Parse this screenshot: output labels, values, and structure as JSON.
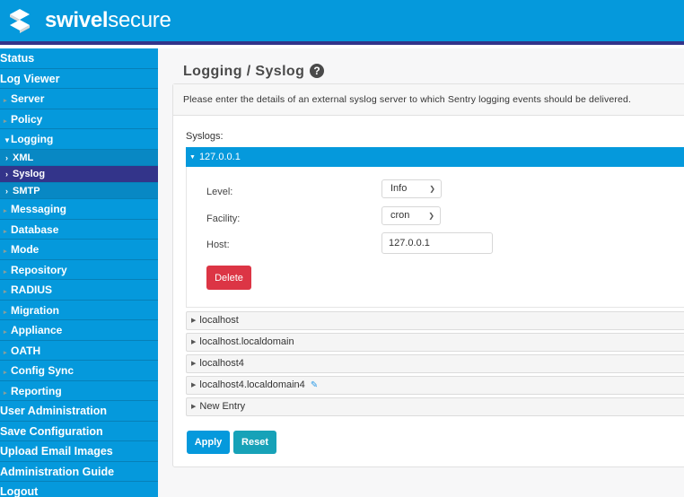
{
  "header": {
    "brand_bold": "swivel",
    "brand_light": "secure"
  },
  "sidebar": {
    "items": [
      {
        "label": "Status",
        "level": "top"
      },
      {
        "label": "Log Viewer",
        "level": "top"
      },
      {
        "label": "Server",
        "level": "sub"
      },
      {
        "label": "Policy",
        "level": "sub"
      },
      {
        "label": "Logging",
        "level": "sub",
        "open": true
      },
      {
        "label": "XML",
        "level": "subsub"
      },
      {
        "label": "Syslog",
        "level": "subsub",
        "active": true
      },
      {
        "label": "SMTP",
        "level": "subsub"
      },
      {
        "label": "Messaging",
        "level": "sub"
      },
      {
        "label": "Database",
        "level": "sub"
      },
      {
        "label": "Mode",
        "level": "sub"
      },
      {
        "label": "Repository",
        "level": "sub"
      },
      {
        "label": "RADIUS",
        "level": "sub"
      },
      {
        "label": "Migration",
        "level": "sub"
      },
      {
        "label": "Appliance",
        "level": "sub"
      },
      {
        "label": "OATH",
        "level": "sub"
      },
      {
        "label": "Config Sync",
        "level": "sub"
      },
      {
        "label": "Reporting",
        "level": "sub"
      },
      {
        "label": "User Administration",
        "level": "top"
      },
      {
        "label": "Save Configuration",
        "level": "top"
      },
      {
        "label": "Upload Email Images",
        "level": "top"
      },
      {
        "label": "Administration Guide",
        "level": "top"
      },
      {
        "label": "Logout",
        "level": "top"
      }
    ]
  },
  "main": {
    "title": "Logging / Syslog",
    "help_glyph": "?",
    "description": "Please enter the details of an external syslog server to which Sentry logging events should be delivered.",
    "syslogs_label": "Syslogs:",
    "open_entry": {
      "name": "127.0.0.1",
      "level_label": "Level:",
      "level_value": "Info",
      "facility_label": "Facility:",
      "facility_value": "cron",
      "host_label": "Host:",
      "host_value": "127.0.0.1",
      "delete_label": "Delete"
    },
    "collapsed_entries": [
      {
        "name": "localhost"
      },
      {
        "name": "localhost.localdomain"
      },
      {
        "name": "localhost4"
      },
      {
        "name": "localhost4.localdomain4",
        "edited": true
      },
      {
        "name": "New Entry"
      }
    ],
    "apply_label": "Apply",
    "reset_label": "Reset"
  },
  "colors": {
    "brand_blue": "#0599dc",
    "active_nav": "#33348a",
    "delete_red": "#dc3545",
    "reset_teal": "#17a2b8"
  }
}
